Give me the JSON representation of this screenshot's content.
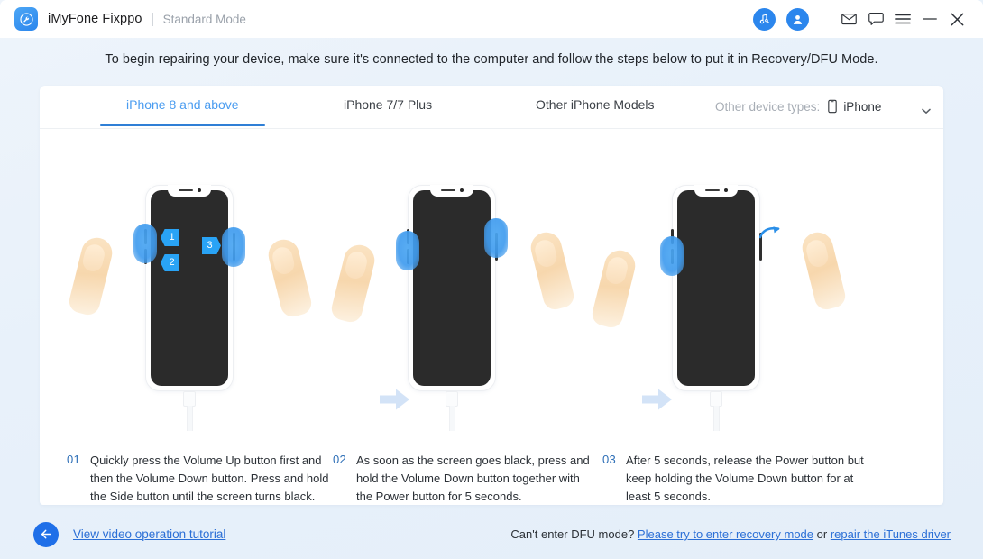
{
  "titlebar": {
    "logo_icon": "wrench-circle-icon",
    "app_name": "iMyFone Fixppo",
    "mode": "Standard Mode",
    "actions": [
      {
        "name": "music-search-icon"
      },
      {
        "name": "user-account-icon"
      },
      {
        "name": "mail-icon"
      },
      {
        "name": "feedback-chat-icon"
      },
      {
        "name": "menu-icon"
      },
      {
        "name": "minimize-icon"
      },
      {
        "name": "close-icon"
      }
    ]
  },
  "instruction": "To begin repairing your device, make sure it's connected to the computer and follow the steps below to put it in Recovery/DFU Mode.",
  "tabs": [
    {
      "label": "iPhone 8 and above",
      "active": true
    },
    {
      "label": "iPhone 7/7 Plus",
      "active": false
    },
    {
      "label": "Other iPhone Models",
      "active": false
    }
  ],
  "device_type": {
    "label": "Other device types:",
    "icon": "phone-outline-icon",
    "value": "iPhone",
    "caret": "chevron-down-icon"
  },
  "steps": [
    {
      "number": "01",
      "text": "Quickly press the Volume Up button first and then the Volume Down button. Press and hold the Side button until the screen turns black.",
      "badges": [
        "1",
        "2",
        "3"
      ]
    },
    {
      "number": "02",
      "text": "As soon as the screen goes black, press and hold the Volume Down button together with the Power button for 5 seconds.",
      "badges": []
    },
    {
      "number": "03",
      "text": "After 5 seconds, release the Power button but keep holding the Volume Down button for at least 5 seconds.",
      "badges": []
    }
  ],
  "footer": {
    "back_icon": "back-arrow-icon",
    "tutorial_link": "View video operation tutorial",
    "help_prefix": "Can't enter DFU mode? ",
    "help_link_1": "Please try to enter recovery mode",
    "help_middle": " or ",
    "help_link_2": "repair the iTunes driver"
  },
  "colors": {
    "accent": "#2b86ed",
    "tab_active": "#4a9cf0",
    "link": "#2b6fd6",
    "badge": "#29a3f5",
    "step_number": "#2e6fb7"
  }
}
